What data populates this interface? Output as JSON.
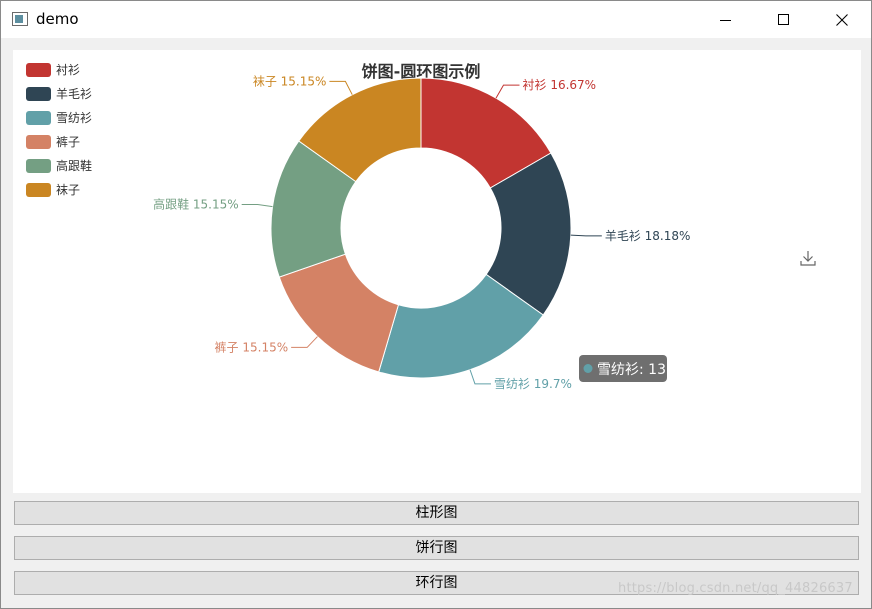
{
  "window": {
    "title": "demo"
  },
  "chart_data": {
    "type": "pie",
    "title": "饼图-圆环图示例",
    "legend_position": "top-left",
    "slices": [
      {
        "name": "衬衫",
        "value": 11,
        "percent": "16.67%",
        "color": "#c23531"
      },
      {
        "name": "羊毛衫",
        "value": 12,
        "percent": "18.18%",
        "color": "#2f4554"
      },
      {
        "name": "雪纺衫",
        "value": 13,
        "percent": "19.7%",
        "color": "#61a0a8"
      },
      {
        "name": "裤子",
        "value": 10,
        "percent": "15.15%",
        "color": "#d48265"
      },
      {
        "name": "高跟鞋",
        "value": 10,
        "percent": "15.15%",
        "color": "#749f83"
      },
      {
        "name": "袜子",
        "value": 10,
        "percent": "15.15%",
        "color": "#ca8622"
      }
    ],
    "tooltip": {
      "text": "雪纺衫: 13",
      "color": "#61a0a8"
    }
  },
  "buttons": {
    "bar": "柱形图",
    "pie": "饼行图",
    "ring": "环行图"
  },
  "watermark": "https://blog.csdn.net/qq_44826637"
}
